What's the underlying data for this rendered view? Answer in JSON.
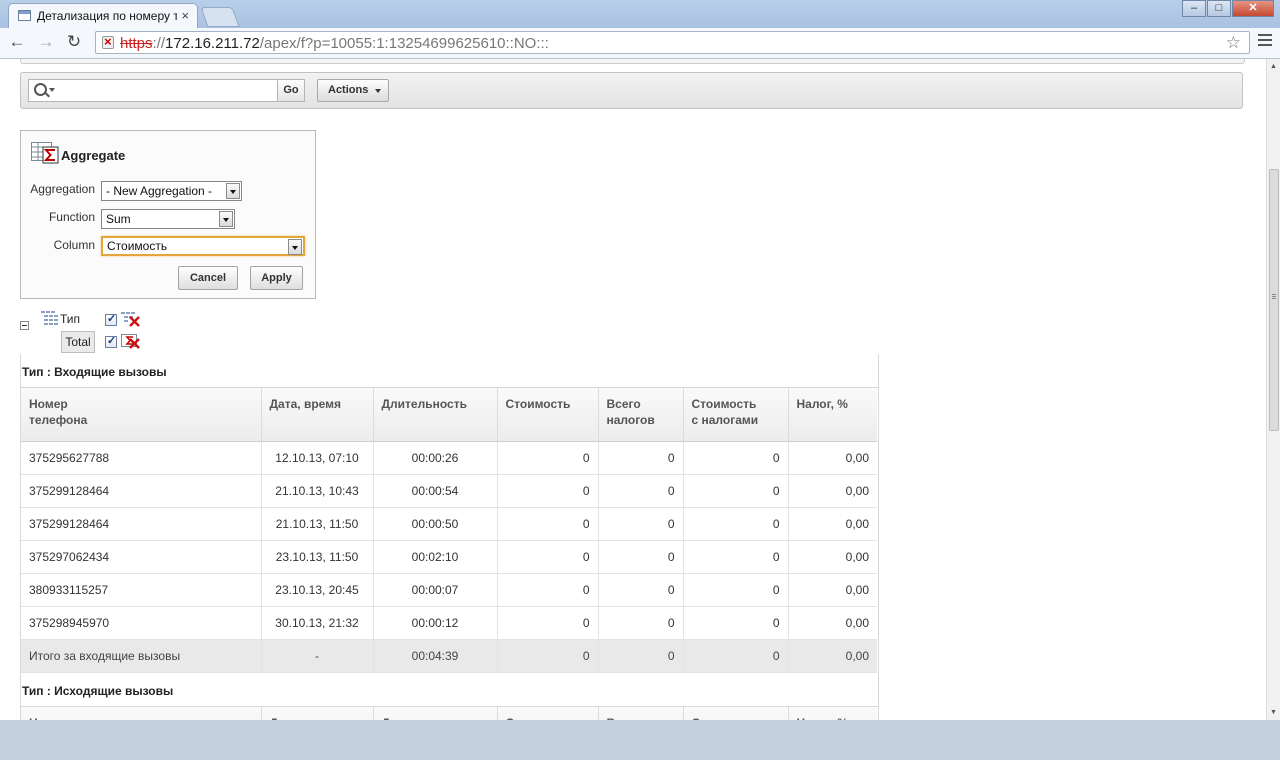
{
  "browser": {
    "tab_title": "Детализация по номеру т",
    "tab_close": "×",
    "url_scheme": "https",
    "url_sep": "://",
    "url_host": "172.16.211.72",
    "url_path": "/apex/f?p=10055:1:13254699625610::NO:::",
    "win_min": "‒",
    "win_max": "□",
    "win_close": "✕",
    "nav_back": "←",
    "nav_forward": "→",
    "nav_reload": "↻",
    "star": "☆"
  },
  "search": {
    "placeholder": "",
    "go_label": "Go",
    "actions_label": "Actions"
  },
  "aggregate": {
    "title": "Aggregate",
    "aggregation_label": "Aggregation",
    "aggregation_value": "- New Aggregation -",
    "function_label": "Function",
    "function_value": "Sum",
    "column_label": "Column",
    "column_value": "Стоимость",
    "cancel_label": "Cancel",
    "apply_label": "Apply"
  },
  "group_by": {
    "column_label": "Тип",
    "total_label": "Total"
  },
  "report": {
    "columns": [
      {
        "line1": "Номер",
        "line2": "телефона"
      },
      {
        "line1": "Дата, время",
        "line2": ""
      },
      {
        "line1": "Длительность",
        "line2": ""
      },
      {
        "line1": "Стоимость",
        "line2": ""
      },
      {
        "line1": "Всего",
        "line2": "налогов"
      },
      {
        "line1": "Стоимость",
        "line2": "с налогами"
      },
      {
        "line1": "Налог, %",
        "line2": ""
      }
    ],
    "groups": [
      {
        "header": "Тип : Входящие вызовы",
        "rows": [
          [
            "375295627788",
            "12.10.13, 07:10",
            "00:00:26",
            "0",
            "0",
            "0",
            "0,00"
          ],
          [
            "375299128464",
            "21.10.13, 10:43",
            "00:00:54",
            "0",
            "0",
            "0",
            "0,00"
          ],
          [
            "375299128464",
            "21.10.13, 11:50",
            "00:00:50",
            "0",
            "0",
            "0",
            "0,00"
          ],
          [
            "375297062434",
            "23.10.13, 11:50",
            "00:02:10",
            "0",
            "0",
            "0",
            "0,00"
          ],
          [
            "380933115257",
            "23.10.13, 20:45",
            "00:00:07",
            "0",
            "0",
            "0",
            "0,00"
          ],
          [
            "375298945970",
            "30.10.13, 21:32",
            "00:00:12",
            "0",
            "0",
            "0",
            "0,00"
          ]
        ],
        "total": [
          "Итого за входящие вызовы",
          "-",
          "00:04:39",
          "0",
          "0",
          "0",
          "0,00"
        ]
      },
      {
        "header": "Тип : Исходящие вызовы",
        "rows": [],
        "total": null
      }
    ]
  }
}
